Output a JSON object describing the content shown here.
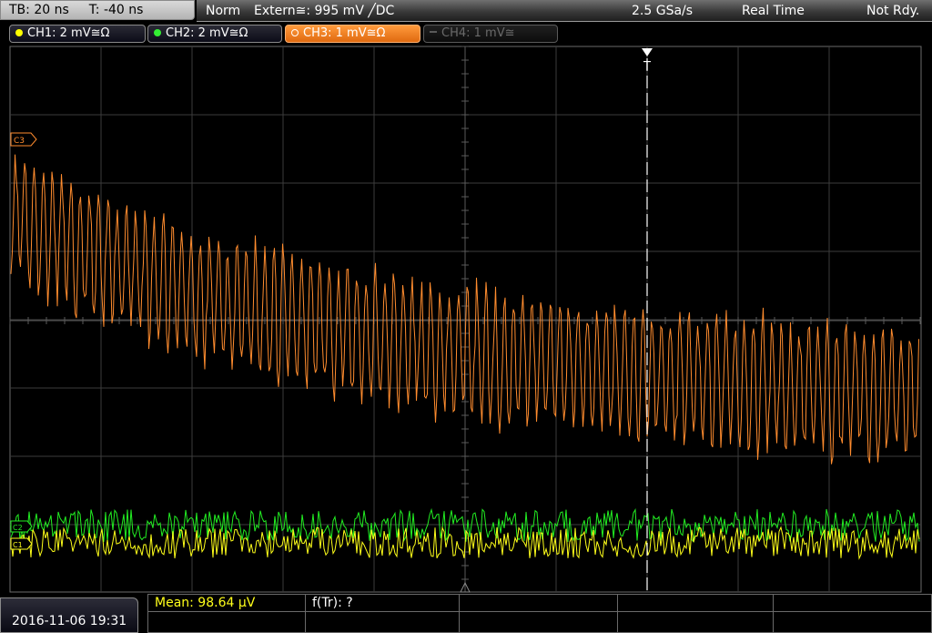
{
  "status": {
    "timebase": "TB: 20 ns",
    "trigger_time": "T: -40 ns",
    "trigger_mode": "Norm",
    "trigger_source": "Extern≅: 995 mV ╱DC",
    "sample_rate": "2.5 GSa/s",
    "acquisition_mode": "Real Time",
    "ready_state": "Not Rdy."
  },
  "channels": [
    {
      "label": "CH1: 2 mV≅Ω",
      "color": "#ffff00",
      "active": true
    },
    {
      "label": "CH2: 2 mV≅Ω",
      "color": "#33ee33",
      "active": true
    },
    {
      "label": "CH3: 1 mV≅Ω",
      "color": "#ff8c2e",
      "active": true,
      "selected": true
    },
    {
      "label": "CH4: 1 mV≅",
      "color": "#6a6a6a",
      "active": false
    }
  ],
  "markers": {
    "ch3": "C3",
    "ch2": "C2",
    "ch1": "C1",
    "trigger": "T"
  },
  "colors": {
    "ch1_trace": "#ffff1a",
    "ch2_trace": "#22ee22",
    "ch3_trace": "#ff8c2e",
    "grid": "#3c3c3c",
    "grid_axis": "#5a5a5a",
    "trigger_line": "#ffffff"
  },
  "measurements": {
    "mean": "Mean: 98.64 µV",
    "rise_freq": "f(Tr): ?"
  },
  "datetime": "2016-11-06 19:31"
}
